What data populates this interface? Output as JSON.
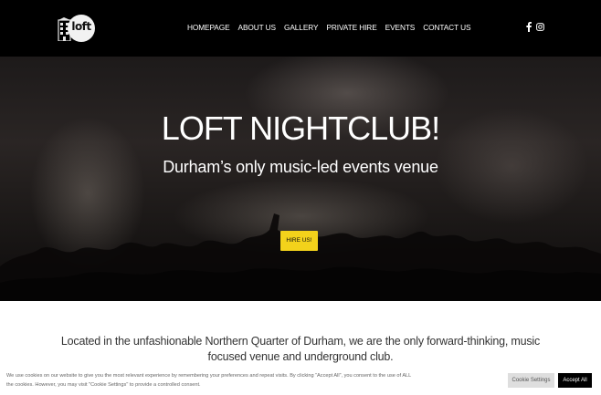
{
  "header": {
    "logo_text": "loft",
    "nav": [
      "HOMEPAGE",
      "ABOUT US",
      "GALLERY",
      "PRIVATE HIRE",
      "EVENTS",
      "CONTACT US"
    ],
    "social_icons": [
      "facebook-icon",
      "instagram-icon"
    ]
  },
  "hero": {
    "title": "LOFT NIGHTCLUB!",
    "subtitle": "Durham’s only music-led events venue",
    "button_label": "HIRE US!",
    "button_color": "#f3d21b"
  },
  "intro": {
    "text": "Located in the unfashionable Northern Quarter of Durham, we are the only forward-thinking, music focused venue and underground club."
  },
  "cookie": {
    "text": "We use cookies on our website to give you the most relevant experience by remembering your preferences and repeat visits. By clicking “Accept All”, you consent to the use of ALL the cookies. However, you may visit \"Cookie Settings\" to provide a controlled consent.",
    "settings_label": "Cookie Settings",
    "accept_label": "Accept All"
  }
}
